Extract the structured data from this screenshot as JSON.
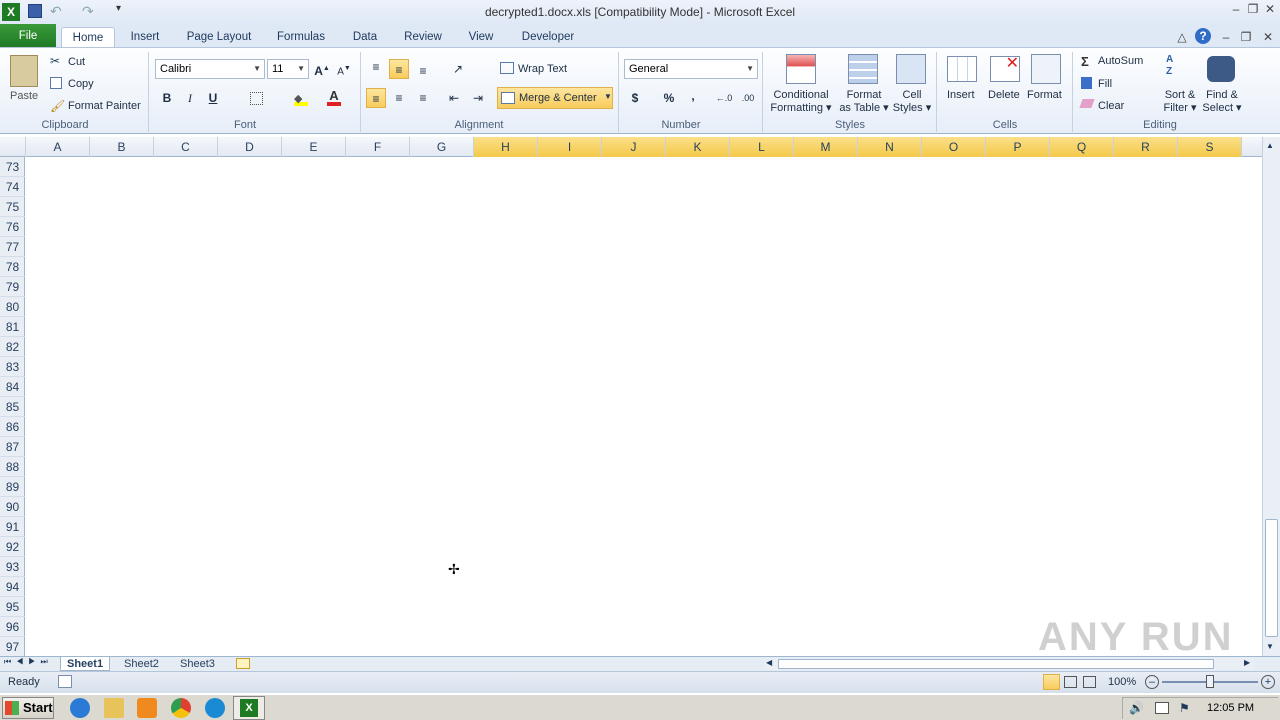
{
  "window": {
    "title": "decrypted1.docx.xls  [Compatibility Mode]  -  Microsoft Excel"
  },
  "tabs": [
    "File",
    "Home",
    "Insert",
    "Page Layout",
    "Formulas",
    "Data",
    "Review",
    "View",
    "Developer"
  ],
  "clipboard": {
    "paste": "Paste",
    "cut": "Cut",
    "copy": "Copy",
    "format_painter": "Format Painter",
    "label": "Clipboard"
  },
  "font": {
    "name": "Calibri",
    "size": "11",
    "label": "Font",
    "bold": "B",
    "italic": "I",
    "underline": "U"
  },
  "alignment": {
    "wrap_text": "Wrap Text",
    "merge_center": "Merge & Center",
    "label": "Alignment"
  },
  "number": {
    "format": "General",
    "label": "Number",
    "currency": "$",
    "percent": "%",
    "comma": ","
  },
  "styles": {
    "conditional1": "Conditional",
    "conditional2": "Formatting",
    "format_table1": "Format",
    "format_table2": "as Table",
    "cell_styles1": "Cell",
    "cell_styles2": "Styles",
    "label": "Styles"
  },
  "cells": {
    "insert": "Insert",
    "delete": "Delete",
    "format": "Format",
    "label": "Cells"
  },
  "editing": {
    "autosum": "AutoSum",
    "fill": "Fill",
    "clear": "Clear",
    "sort1": "Sort &",
    "sort2": "Filter",
    "find1": "Find &",
    "find2": "Select",
    "label": "Editing"
  },
  "columns": [
    "A",
    "B",
    "C",
    "D",
    "E",
    "F",
    "G",
    "H",
    "I",
    "J",
    "K",
    "L",
    "M",
    "N",
    "O",
    "P",
    "Q",
    "R",
    "S"
  ],
  "rows": [
    "73",
    "74",
    "75",
    "76",
    "77",
    "78",
    "79",
    "80",
    "81",
    "82",
    "83",
    "84",
    "85",
    "86",
    "87",
    "88",
    "89",
    "90",
    "91",
    "92",
    "93",
    "94",
    "95",
    "96",
    "97"
  ],
  "sheets": [
    "Sheet1",
    "Sheet2",
    "Sheet3"
  ],
  "status": {
    "ready": "Ready",
    "zoom": "100%"
  },
  "watermark": "ANY RUN",
  "taskbar": {
    "start": "Start",
    "clock": "12:05 PM"
  }
}
